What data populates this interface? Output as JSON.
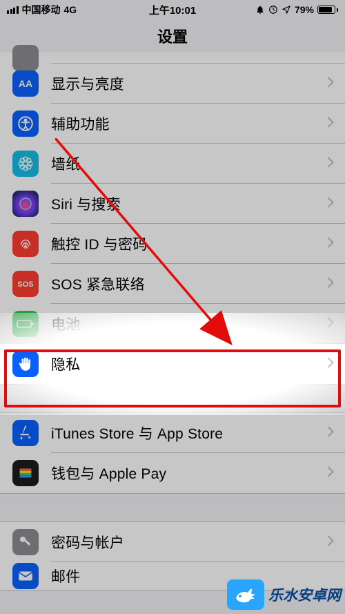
{
  "status": {
    "carrier": "中国移动",
    "network": "4G",
    "time": "上午10:01",
    "battery_pct": "79%"
  },
  "nav": {
    "title": "设置"
  },
  "rows": {
    "display": {
      "label": "显示与亮度"
    },
    "access": {
      "label": "辅助功能"
    },
    "wall": {
      "label": "墙纸"
    },
    "siri": {
      "label": "Siri 与搜索"
    },
    "touchid": {
      "label": "触控 ID 与密码"
    },
    "sos": {
      "label": "SOS 紧急联络"
    },
    "battery": {
      "label": "电池"
    },
    "privacy": {
      "label": "隐私"
    },
    "itunes": {
      "label": "iTunes Store 与 App Store"
    },
    "wallet": {
      "label": "钱包与 Apple Pay"
    },
    "passacc": {
      "label": "密码与帐户"
    },
    "mail": {
      "label": "邮件"
    }
  },
  "icon_colors": {
    "display": "#0a60ff",
    "access": "#0a60ff",
    "wall": "#16bde7",
    "siri": "#222",
    "touchid": "#ff3c30",
    "sos": "#ff3c30",
    "battery": "#33c759",
    "privacy": "#0a60ff",
    "itunes": "#0a60ff",
    "wallet": "#222",
    "passacc": "#8e8e93",
    "mail": "#0a60ff"
  },
  "watermark": {
    "text": "乐水安卓网"
  }
}
